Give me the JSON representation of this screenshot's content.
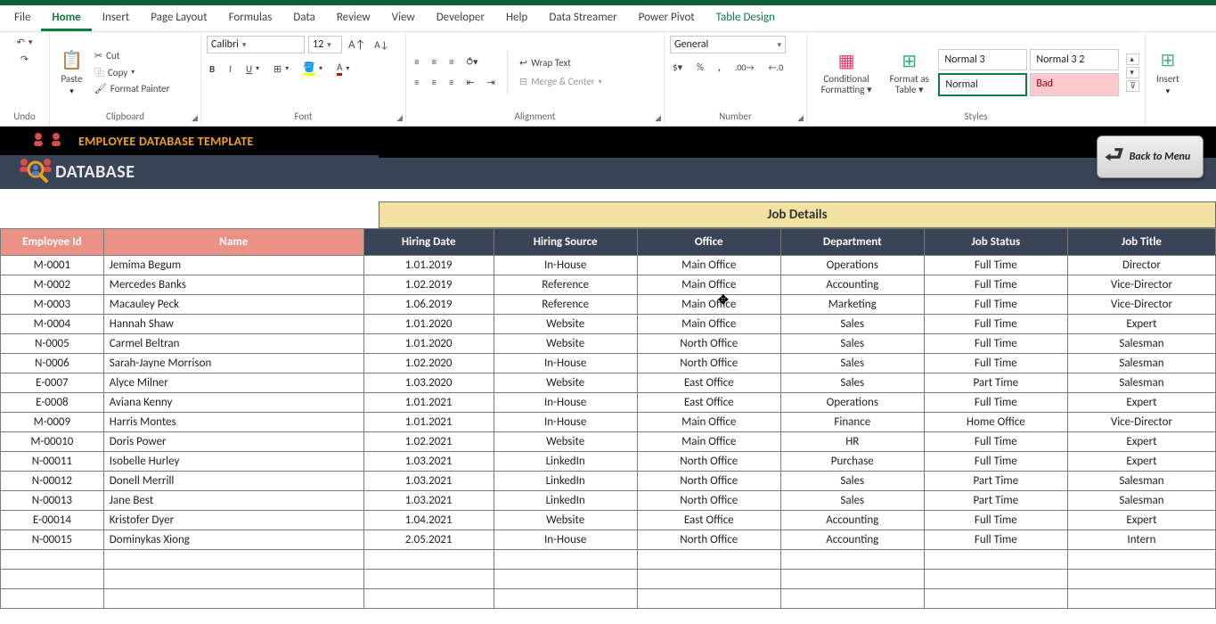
{
  "menu": {
    "tabs": [
      "File",
      "Home",
      "Insert",
      "Page Layout",
      "Formulas",
      "Data",
      "Review",
      "View",
      "Developer",
      "Help",
      "Data Streamer",
      "Power Pivot",
      "Table Design"
    ],
    "active": 1
  },
  "ribbon": {
    "undo": "Undo",
    "clipboard": {
      "label": "Clipboard",
      "paste": "Paste",
      "cut": "Cut",
      "copy": "Copy",
      "fmtpainter": "Format Painter"
    },
    "font": {
      "label": "Font",
      "name": "Calibri",
      "size": "12"
    },
    "alignment": {
      "label": "Alignment",
      "wrap": "Wrap Text",
      "merge": "Merge & Center"
    },
    "number": {
      "label": "Number",
      "format": "General"
    },
    "styles": {
      "label": "Styles",
      "cond": "Conditional Formatting",
      "fat": "Format as Table",
      "cells": [
        "Normal 3",
        "Normal 3 2",
        "Normal",
        "Bad"
      ]
    },
    "cells": {
      "insert": "Insert"
    }
  },
  "banner": {
    "title1": "EMPLOYEE DATABASE TEMPLATE",
    "title2": "DATABASE",
    "back": "Back to Menu"
  },
  "section_header": "Job Details",
  "columns": [
    "Employee Id",
    "Name",
    "Hiring Date",
    "Hiring Source",
    "Office",
    "Department",
    "Job Status",
    "Job Title"
  ],
  "rows": [
    {
      "id": "M-0001",
      "name": "Jemima Begum",
      "hd": "1.01.2019",
      "hs": "In-House",
      "off": "Main Office",
      "dep": "Operations",
      "js": "Full Time",
      "jt": "Director"
    },
    {
      "id": "M-0002",
      "name": "Mercedes Banks",
      "hd": "1.02.2019",
      "hs": "Reference",
      "off": "Main Office",
      "dep": "Accounting",
      "js": "Full Time",
      "jt": "Vice-Director"
    },
    {
      "id": "M-0003",
      "name": "Macauley Peck",
      "hd": "1.06.2019",
      "hs": "Reference",
      "off": "Main Office",
      "dep": "Marketing",
      "js": "Full Time",
      "jt": "Vice-Director"
    },
    {
      "id": "M-0004",
      "name": "Hannah Shaw",
      "hd": "1.01.2020",
      "hs": "Website",
      "off": "Main Office",
      "dep": "Sales",
      "js": "Full Time",
      "jt": "Expert"
    },
    {
      "id": "N-0005",
      "name": "Carmel Beltran",
      "hd": "1.01.2020",
      "hs": "Website",
      "off": "North Office",
      "dep": "Sales",
      "js": "Full Time",
      "jt": "Salesman"
    },
    {
      "id": "N-0006",
      "name": "Sarah-Jayne Morrison",
      "hd": "1.02.2020",
      "hs": "In-House",
      "off": "North Office",
      "dep": "Sales",
      "js": "Full Time",
      "jt": "Salesman"
    },
    {
      "id": "E-0007",
      "name": "Alyce Milner",
      "hd": "1.03.2020",
      "hs": "Website",
      "off": "East Office",
      "dep": "Sales",
      "js": "Part Time",
      "jt": "Salesman"
    },
    {
      "id": "E-0008",
      "name": "Aviana Kenny",
      "hd": "1.01.2021",
      "hs": "In-House",
      "off": "East Office",
      "dep": "Operations",
      "js": "Full Time",
      "jt": "Expert"
    },
    {
      "id": "M-0009",
      "name": "Harris Montes",
      "hd": "1.01.2021",
      "hs": "In-House",
      "off": "Main Office",
      "dep": "Finance",
      "js": "Home Office",
      "jt": "Vice-Director"
    },
    {
      "id": "M-00010",
      "name": "Doris Power",
      "hd": "1.02.2021",
      "hs": "Website",
      "off": "Main Office",
      "dep": "HR",
      "js": "Full Time",
      "jt": "Expert"
    },
    {
      "id": "N-00011",
      "name": "Isobelle Hurley",
      "hd": "1.03.2021",
      "hs": "LinkedIn",
      "off": "North Office",
      "dep": "Purchase",
      "js": "Full Time",
      "jt": "Expert"
    },
    {
      "id": "N-00012",
      "name": "Donell Merrill",
      "hd": "1.03.2021",
      "hs": "LinkedIn",
      "off": "North Office",
      "dep": "Sales",
      "js": "Part Time",
      "jt": "Salesman"
    },
    {
      "id": "N-00013",
      "name": "Jane Best",
      "hd": "1.03.2021",
      "hs": "LinkedIn",
      "off": "North Office",
      "dep": "Sales",
      "js": "Part Time",
      "jt": "Salesman"
    },
    {
      "id": "E-00014",
      "name": "Kristofer Dyer",
      "hd": "1.04.2021",
      "hs": "Website",
      "off": "East Office",
      "dep": "Accounting",
      "js": "Full Time",
      "jt": "Expert"
    },
    {
      "id": "N-00015",
      "name": "Dominykas Xiong",
      "hd": "2.05.2021",
      "hs": "In-House",
      "off": "North Office",
      "dep": "Accounting",
      "js": "Full Time",
      "jt": "Intern"
    }
  ],
  "empty_rows": 3
}
